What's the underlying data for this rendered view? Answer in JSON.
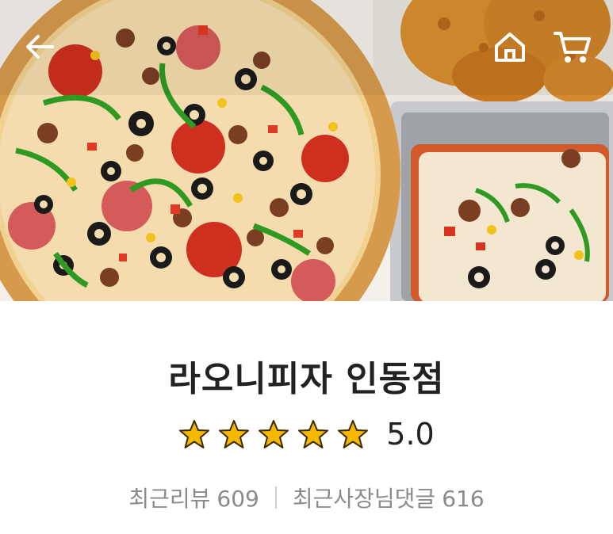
{
  "store": {
    "name": "라오니피자 인동점"
  },
  "rating": {
    "value": "5.0",
    "stars": 5,
    "max": 5,
    "star_color": "#f5b800"
  },
  "reviews": {
    "recent_label": "최근리뷰",
    "recent_count": "609",
    "owner_label": "최근사장님댓글",
    "owner_count": "616"
  },
  "nav": {
    "icons": [
      "arrow-left-icon",
      "home-icon",
      "cart-icon"
    ]
  }
}
